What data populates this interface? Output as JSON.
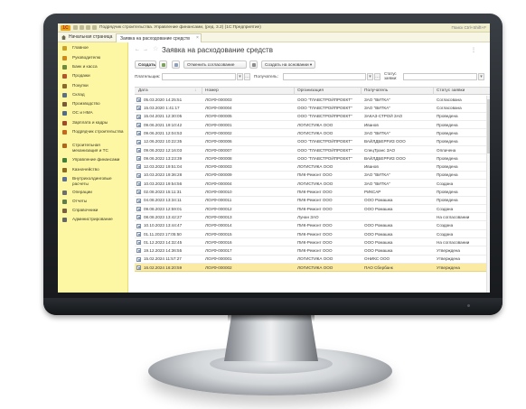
{
  "window": {
    "title": "Подрядчик строительства. Управление финансами, (ред. 3.2) (1С:Предприятие)",
    "right_text": "Поиск Ctrl+Shift+F"
  },
  "tabs": {
    "home": "Начальная страница",
    "active": "Заявка на расходование средств"
  },
  "sidebar": {
    "items": [
      {
        "label": "Главное",
        "icon": "home-icon",
        "color": "#c9a227"
      },
      {
        "label": "Руководителю",
        "icon": "chart-icon",
        "color": "#d08a1b"
      },
      {
        "label": "Банк и касса",
        "icon": "bank-icon",
        "color": "#6f8a3a"
      },
      {
        "label": "Продажи",
        "icon": "cart-icon",
        "color": "#b3542a"
      },
      {
        "label": "Покупки",
        "icon": "basket-icon",
        "color": "#8a6a2a"
      },
      {
        "label": "Склад",
        "icon": "warehouse-icon",
        "color": "#5d6f85"
      },
      {
        "label": "Производство",
        "icon": "factory-icon",
        "color": "#7a5a36"
      },
      {
        "label": "ОС и НМА",
        "icon": "assets-icon",
        "color": "#4f6d8a"
      },
      {
        "label": "Зарплата и кадры",
        "icon": "people-icon",
        "color": "#a14a2a"
      },
      {
        "label": "Подрядчик строительства",
        "icon": "builder-icon",
        "color": "#c6661e"
      },
      {
        "label": "Строительная механизация и ТС",
        "icon": "crane-icon",
        "color": "#b0661a"
      },
      {
        "label": "Управление финансами",
        "icon": "finance-icon",
        "color": "#3f7f3a"
      },
      {
        "label": "Казначейство",
        "icon": "treasury-icon",
        "color": "#8c6a21"
      },
      {
        "label": "Внутрихолдинговые расчеты",
        "icon": "holding-icon",
        "color": "#5a6f9a"
      },
      {
        "label": "Операции",
        "icon": "operations-icon",
        "color": "#6d6d6d"
      },
      {
        "label": "Отчеты",
        "icon": "reports-icon",
        "color": "#5e7d4a"
      },
      {
        "label": "Справочники",
        "icon": "book-icon",
        "color": "#7a6040"
      },
      {
        "label": "Администрирование",
        "icon": "gear-icon",
        "color": "#666666"
      }
    ]
  },
  "document": {
    "title": "Заявка на расходование средств"
  },
  "toolbar": {
    "create": "Создать",
    "cancel_approval": "Отменить согласование",
    "create_based_on": "Создать на основании ▾"
  },
  "filters": {
    "payer_label": "Плательщик:",
    "recipient_label": "Получатель:",
    "status_label": "Статус заявки:"
  },
  "table": {
    "columns": [
      "Дата",
      "Номер",
      "Организация",
      "Получатель",
      "Статус заявки"
    ],
    "rows": [
      [
        "05.03.2020 14:25:51",
        "ЛОУФ-000003",
        "ООО \"ГЛАВСТРОЙПРОЕКТ\"",
        "ЗАО \"ВИТКА\"",
        "Согласована"
      ],
      [
        "15.03.2020 1:41:17",
        "ЛОУФ-000004",
        "ООО \"ГЛАВСТРОЙПРОЕКТ\"",
        "ЗАО \"ВИТКА\"",
        "Согласована"
      ],
      [
        "15.04.2021 12:30:05",
        "ЛОУФ-000005",
        "ООО \"ГЛАВСТРОЙПРОЕКТ\"",
        "ЗАКАЗ-СТРОЙ ЗАО",
        "Проведена"
      ],
      [
        "09.06.2021 19:10:42",
        "ЛОУФ-000001",
        "ЛОГИСТИКА ООО",
        "Иванов",
        "Проведена"
      ],
      [
        "09.06.2021 12:04:53",
        "ЛОУФ-000002",
        "ЛОГИСТИКА ООО",
        "ЗАО \"ВИТКА\"",
        "Проведена"
      ],
      [
        "12.06.2022 10:22:35",
        "ЛОУФ-000006",
        "ООО \"ГЛАВСТРОЙПРОЕКТ\"",
        "ВАЙЛДБЕРРИЗ ООО",
        "Проведена"
      ],
      [
        "09.06.2022 12:16:03",
        "ЛОУФ-000007",
        "ООО \"ГЛАВСТРОЙПРОЕКТ\"",
        "СпецТранс ЗАО",
        "Оплачена"
      ],
      [
        "09.06.2022 13:23:39",
        "ЛОУФ-000008",
        "ООО \"ГЛАВСТРОЙПРОЕКТ\"",
        "ВАЙЛДБЕРРИЗ ООО",
        "Проведена"
      ],
      [
        "12.03.2022 19:51:04",
        "ЛОУФ-000003",
        "ЛОГИСТИКА ООО",
        "Иванов",
        "Проведена"
      ],
      [
        "10.03.2023 19:36:28",
        "ЛОУФ-000009",
        "ПИК-Ремонт ООО",
        "ЗАО \"ВИТКА\"",
        "Проведена"
      ],
      [
        "10.03.2023 19:54:56",
        "ЛОУФ-000004",
        "ЛОГИСТИКА ООО",
        "ЗАО \"ВИТКА\"",
        "Создана"
      ],
      [
        "02.08.2023 15:11:31",
        "ЛОУФ-000010",
        "ПИК-Ремонт ООО",
        "РИКСАР",
        "Проведена"
      ],
      [
        "04.08.2023 13:34:11",
        "ЛОУФ-000011",
        "ПИК-Ремонт ООО",
        "ООО Ромашка",
        "Проведена"
      ],
      [
        "09.08.2023 12:59:01",
        "ЛОУФ-000012",
        "ПИК-Ремонт ООО",
        "ООО Ромашка",
        "Создана"
      ],
      [
        "08.08.2023 13:42:27",
        "ЛОУФ-000013",
        "Лунан ЗАО",
        "",
        "На согласовании"
      ],
      [
        "10.10.2023 13:44:47",
        "ЛОУФ-000014",
        "ПИК-Ремонт ООО",
        "ООО Ромашка",
        "Создана"
      ],
      [
        "01.11.2023 17:05:50",
        "ЛОУФ-000015",
        "ПИК-Ремонт ООО",
        "ООО Ромашка",
        "Создана"
      ],
      [
        "01.12.2023 14:32:45",
        "ЛОУФ-000016",
        "ПИК-Ремонт ООО",
        "ООО Ромашка",
        "На согласовании"
      ],
      [
        "19.12.2023 14:36:55",
        "ЛОУФ-000017",
        "ПИК-Ремонт ООО",
        "ООО Ромашка",
        "Утверждена"
      ],
      [
        "15.02.2024 11:57:27",
        "ЛОУФ-000001",
        "ЛОГИСТИКА ООО",
        "ОНИКС ООО",
        "Утверждена"
      ],
      [
        "16.02.2024 16:20:59",
        "ЛОУФ-000002",
        "ЛОГИСТИКА ООО",
        "ПАО Сбербанк",
        "Утверждена"
      ]
    ],
    "selected_index": 20
  }
}
